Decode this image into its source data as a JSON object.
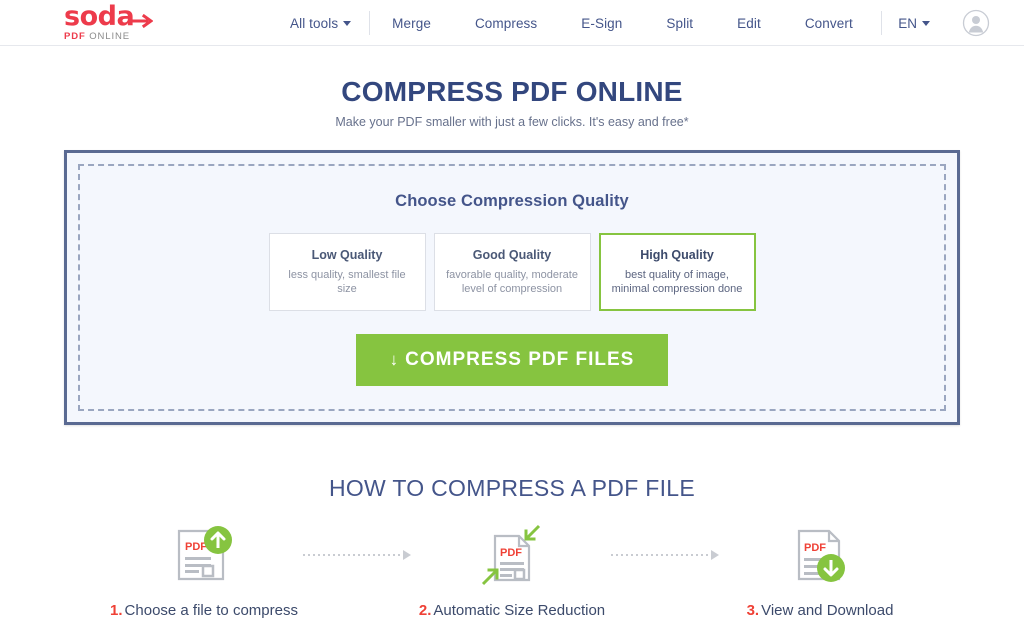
{
  "brand": {
    "logo_word": "soda",
    "logo_sub_primary": "PDF",
    "logo_sub_secondary": "ONLINE",
    "red": "#ed3b4b",
    "navy": "#33477e",
    "green": "#86c440"
  },
  "header": {
    "nav": [
      {
        "label": "All tools",
        "has_caret": true
      },
      {
        "label": "Merge",
        "has_caret": false
      },
      {
        "label": "Compress",
        "has_caret": false
      },
      {
        "label": "E-Sign",
        "has_caret": false
      },
      {
        "label": "Split",
        "has_caret": false
      },
      {
        "label": "Edit",
        "has_caret": false
      },
      {
        "label": "Convert",
        "has_caret": false
      }
    ],
    "language": "EN",
    "account_icon": "user-avatar-icon"
  },
  "hero": {
    "title": "COMPRESS PDF ONLINE",
    "subtitle": "Make your PDF smaller with just a few clicks. It's easy and free*"
  },
  "dropzone": {
    "choose_title": "Choose Compression Quality",
    "quality_options": [
      {
        "name": "Low Quality",
        "description": "less quality, smallest file size",
        "selected": false
      },
      {
        "name": "Good Quality",
        "description": "favorable quality, moderate level of compression",
        "selected": false
      },
      {
        "name": "High Quality",
        "description": "best quality of image, minimal compression done",
        "selected": true
      }
    ],
    "button_arrow": "↓",
    "button_label": "COMPRESS PDF FILES"
  },
  "howto": {
    "heading": "HOW TO COMPRESS A PDF FILE",
    "steps": [
      {
        "number": "1.",
        "label": "Choose a file to compress",
        "icon": "pdf-upload-icon"
      },
      {
        "number": "2.",
        "label": "Automatic Size Reduction",
        "icon": "pdf-compress-icon"
      },
      {
        "number": "3.",
        "label": "View and Download",
        "icon": "pdf-download-icon"
      }
    ]
  }
}
